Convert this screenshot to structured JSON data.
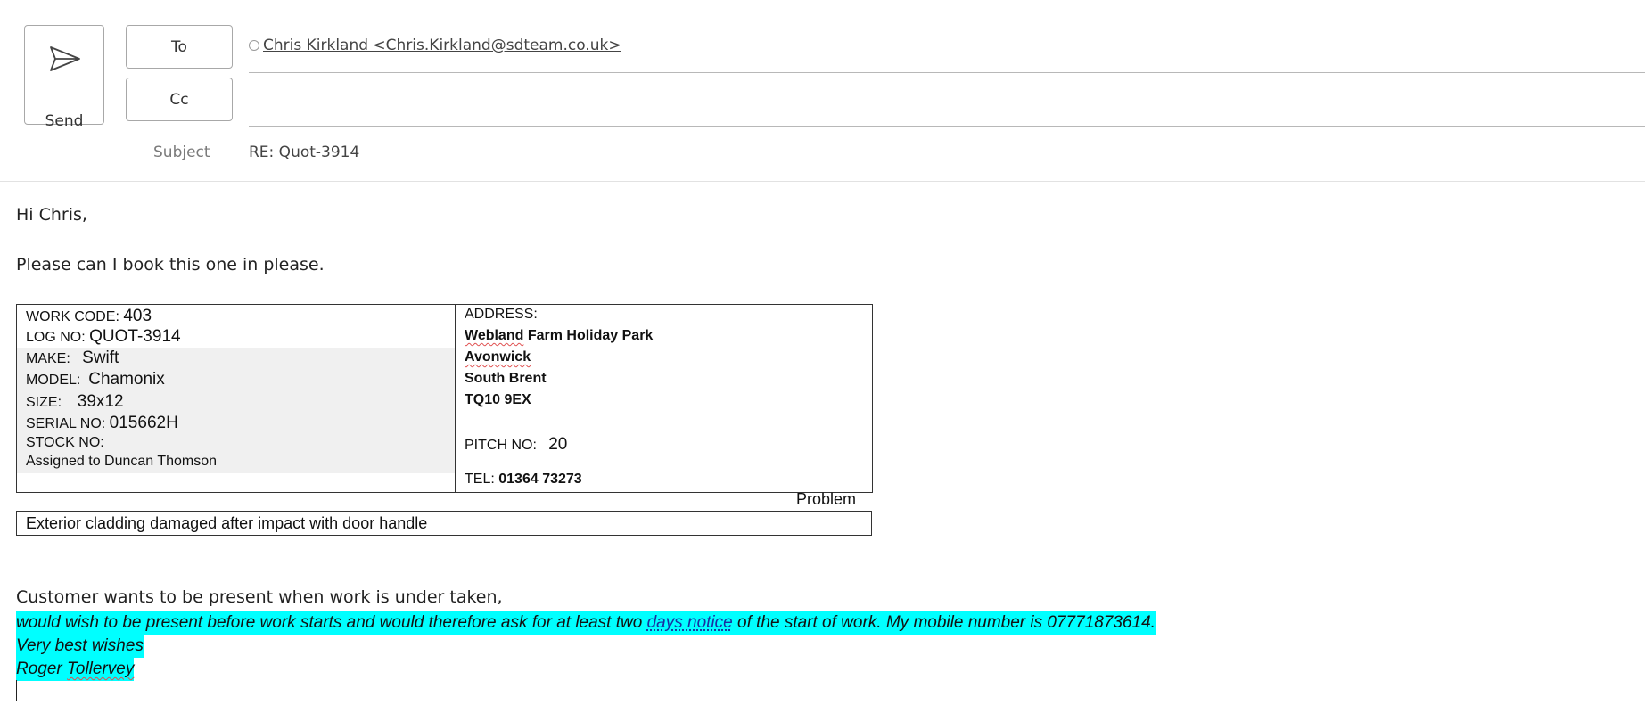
{
  "header": {
    "send_label": "Send",
    "to_label": "To",
    "cc_label": "Cc",
    "to_recipient": "Chris Kirkland <Chris.Kirkland@sdteam.co.uk>",
    "cc_value": "",
    "subject_label": "Subject",
    "subject_value": "RE: Quot-3914"
  },
  "body": {
    "greeting": "Hi Chris,",
    "request": "Please can I book this one in please.",
    "job_card": {
      "work_code_label": "WORK CODE:",
      "work_code": "403",
      "log_no_label": "LOG NO:",
      "log_no": "QUOT-3914",
      "make_label": "MAKE:",
      "make": "Swift",
      "model_label": "MODEL:",
      "model": "Chamonix",
      "size_label": "SIZE:",
      "size": "39x12",
      "serial_label": "SERIAL NO:",
      "serial": "015662H",
      "stock_label": "STOCK NO:",
      "assigned": "Assigned to Duncan Thomson",
      "address_label": "ADDRESS:",
      "address_line1_a": "Webland",
      "address_line1_b": " Farm Holiday Park",
      "address_line2": "Avonwick",
      "address_line3": "South Brent",
      "address_line4": "TQ10 9EX",
      "pitch_label": "PITCH NO:",
      "pitch": "20",
      "tel_label": "TEL:",
      "tel": "01364 73273"
    },
    "problem_label": "Problem",
    "problem_text": "Exterior cladding damaged after impact with door handle",
    "customer_note": "Customer wants to be present when work is under taken,",
    "quote_line1_pre": "would wish to be present before work starts and would therefore ask for at least two ",
    "quote_line1_link": "days notice",
    "quote_line1_post": " of the start of work. My mobile number is 07771873614.",
    "quote_line2": "Very best wishes",
    "quote_line3_a": "Roger ",
    "quote_line3_b": "Tollervey"
  },
  "colors": {
    "highlight": "#00ffff",
    "link": "#1a2fa0",
    "border": "#a8a8a8"
  },
  "icons": {
    "send": "paper-plane-icon",
    "presence": "presence-circle-icon"
  }
}
